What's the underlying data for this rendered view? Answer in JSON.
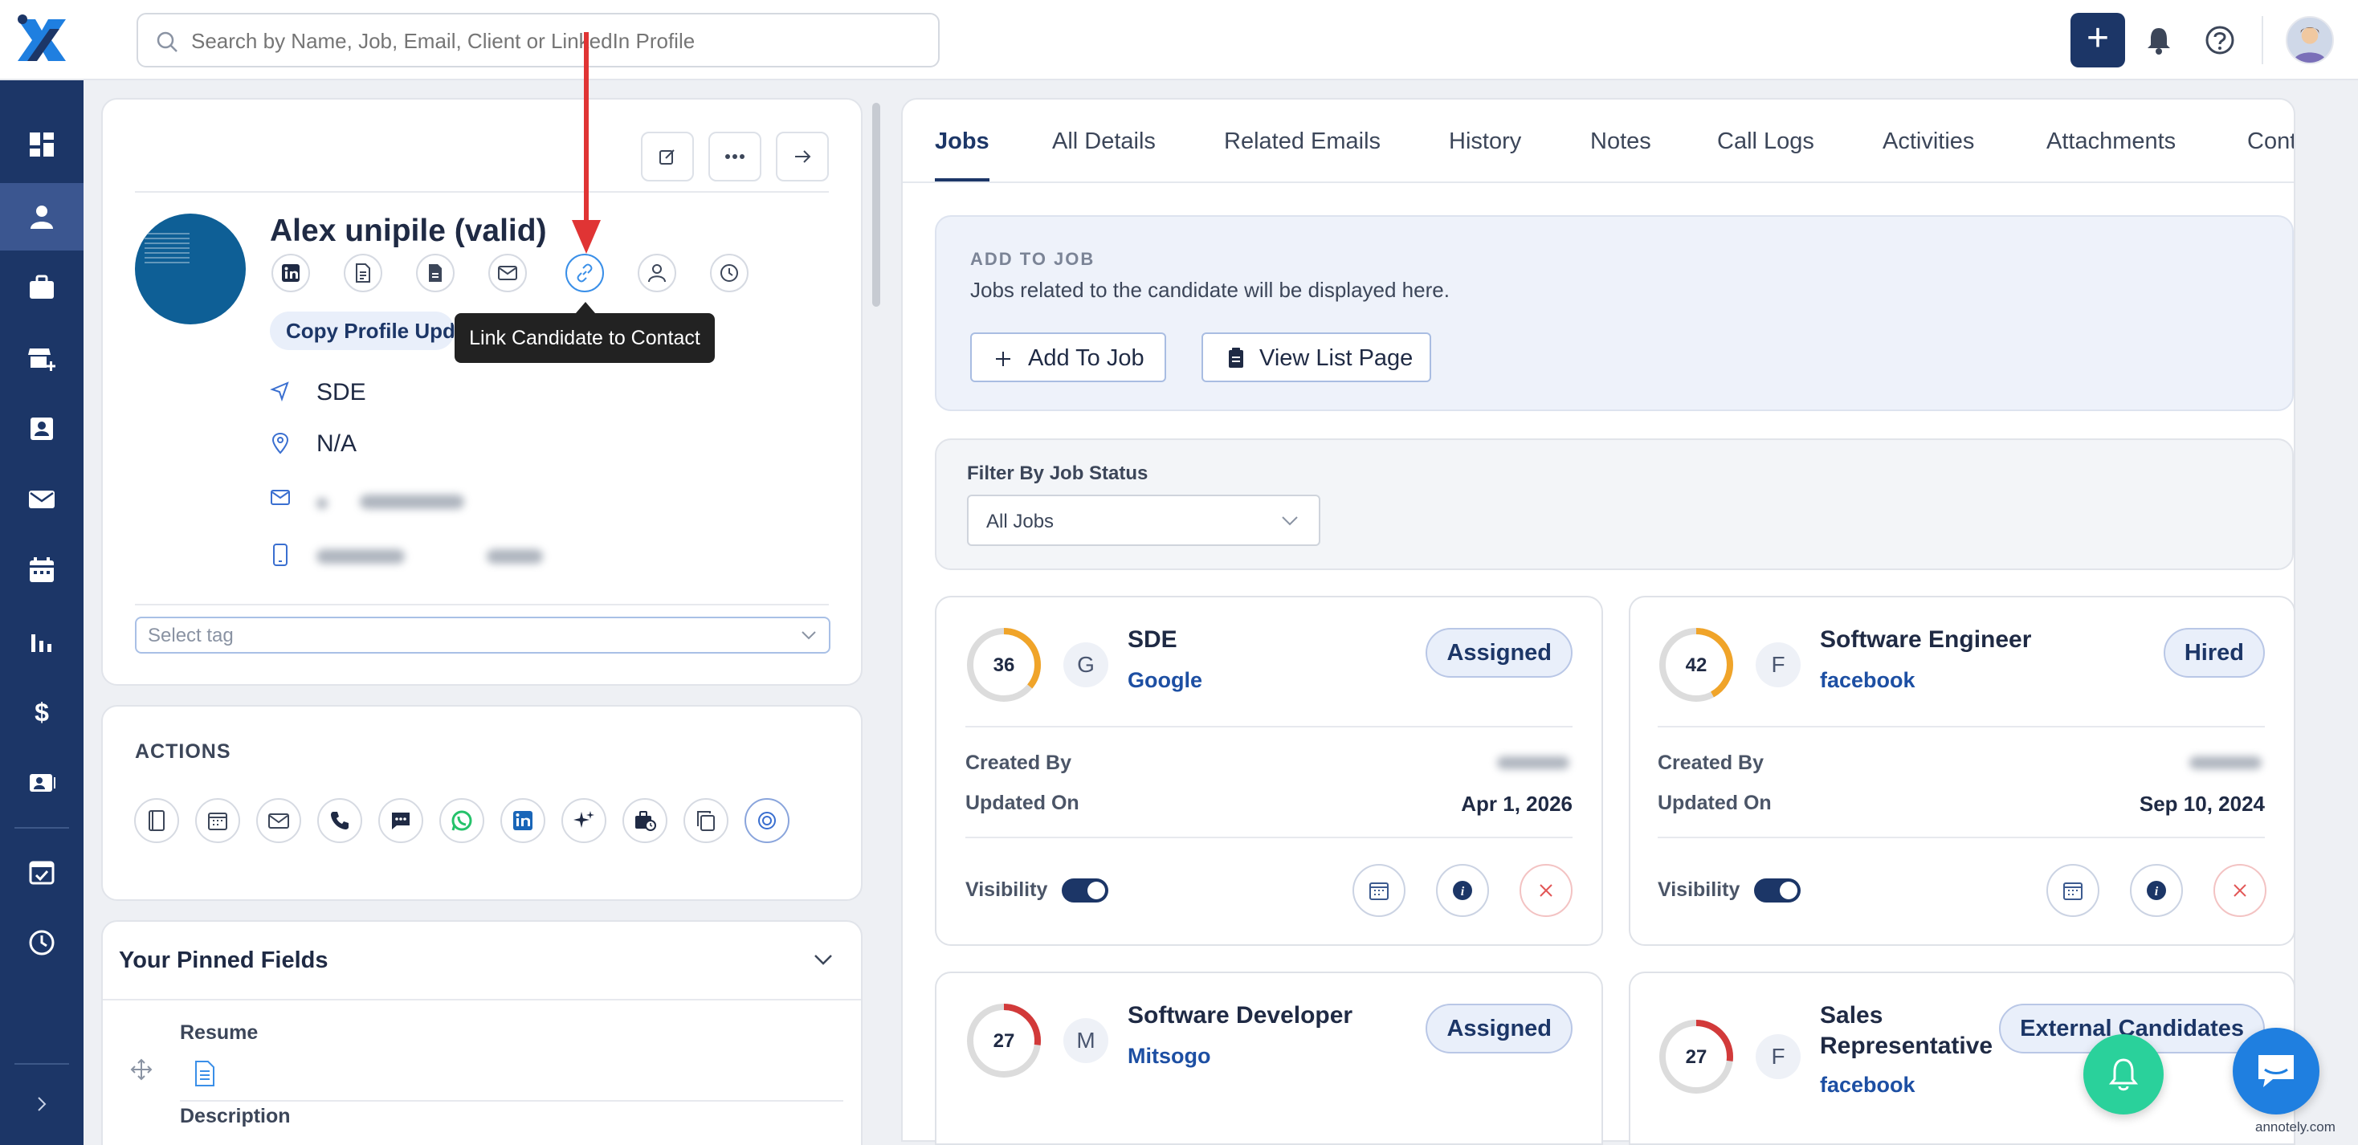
{
  "search": {
    "placeholder": "Search by Name, Job, Email, Client or LinkedIn Profile"
  },
  "topbar": {
    "add_label": "+"
  },
  "profile": {
    "name": "Alex unipile (valid)",
    "copy_profile_label": "Copy Profile Upda",
    "tooltip": "Link Candidate to Contact",
    "title": "SDE",
    "location": "N/A",
    "tag_placeholder": "Select tag"
  },
  "actions": {
    "heading": "ACTIONS"
  },
  "pinned": {
    "heading": "Your Pinned Fields",
    "resume_label": "Resume",
    "description_label": "Description"
  },
  "tabs": [
    "Jobs",
    "All Details",
    "Related Emails",
    "History",
    "Notes",
    "Call Logs",
    "Activities",
    "Attachments",
    "Cont"
  ],
  "add_to_job": {
    "heading": "ADD TO JOB",
    "subtitle": "Jobs related to the candidate will be displayed here.",
    "add_button": "Add To Job",
    "view_button": "View List Page"
  },
  "filter": {
    "label": "Filter By Job Status",
    "selected": "All Jobs"
  },
  "job_labels": {
    "created_by": "Created By",
    "updated_on": "Updated On",
    "visibility": "Visibility"
  },
  "jobs": [
    {
      "score": "36",
      "score_fraction": 0.36,
      "ring_color": "#f0a429",
      "initial": "G",
      "title": "SDE",
      "company": "Google",
      "status": "Assigned",
      "updated_on": "Apr 1, 2026"
    },
    {
      "score": "42",
      "score_fraction": 0.42,
      "ring_color": "#f0a429",
      "initial": "F",
      "title": "Software Engineer",
      "company": "facebook",
      "status": "Hired",
      "updated_on": "Sep 10, 2024"
    },
    {
      "score": "27",
      "score_fraction": 0.27,
      "ring_color": "#d23a3a",
      "initial": "M",
      "title": "Software Developer",
      "company": "Mitsogo",
      "status": "Assigned"
    },
    {
      "score": "27",
      "score_fraction": 0.27,
      "ring_color": "#d23a3a",
      "initial": "F",
      "title_line1": "Sales",
      "title_line2": "Representative",
      "company": "facebook",
      "status": "External Candidates"
    }
  ],
  "watermark": "annotely.com",
  "colors": {
    "primary": "#1c3667",
    "link": "#1d4fa3",
    "fab_green": "#2ad19b",
    "fab_blue": "#1f7fe0",
    "annotation": "#e03434"
  }
}
